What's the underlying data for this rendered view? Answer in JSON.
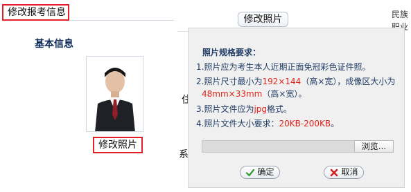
{
  "page": {
    "tab_title": "修改报考信息",
    "section_title": "基本信息",
    "photo_edit_label": "修改照片",
    "bg_ghost_1": "住",
    "bg_ghost_2": "系"
  },
  "popup": {
    "title": "修改照片",
    "right_ghost": [
      "民族",
      "职业"
    ]
  },
  "dialog": {
    "requirements_title": "照片规格要求：",
    "lines": [
      {
        "text": "1.照片应为考生本人近期正面免冠彩色证件照。"
      },
      {
        "pre": "2.照片尺寸最小为",
        "red": "192×144",
        "post": "（高×宽），成像区大小为"
      },
      {
        "pre": "",
        "red": "48mm×33mm",
        "post": "（高×宽）。"
      },
      {
        "pre": "3.照片文件应为",
        "red": "jpg",
        "post": "格式。"
      },
      {
        "pre": "4.照片文件大小要求：",
        "red": "20KB-200KB",
        "post": "。"
      }
    ],
    "browse_label": "浏览...",
    "ok_label": "确定",
    "cancel_label": "取消"
  },
  "colors": {
    "red_border": "#e3202a",
    "text_blue": "#1f3b64",
    "highlight_red": "#e2231a"
  }
}
